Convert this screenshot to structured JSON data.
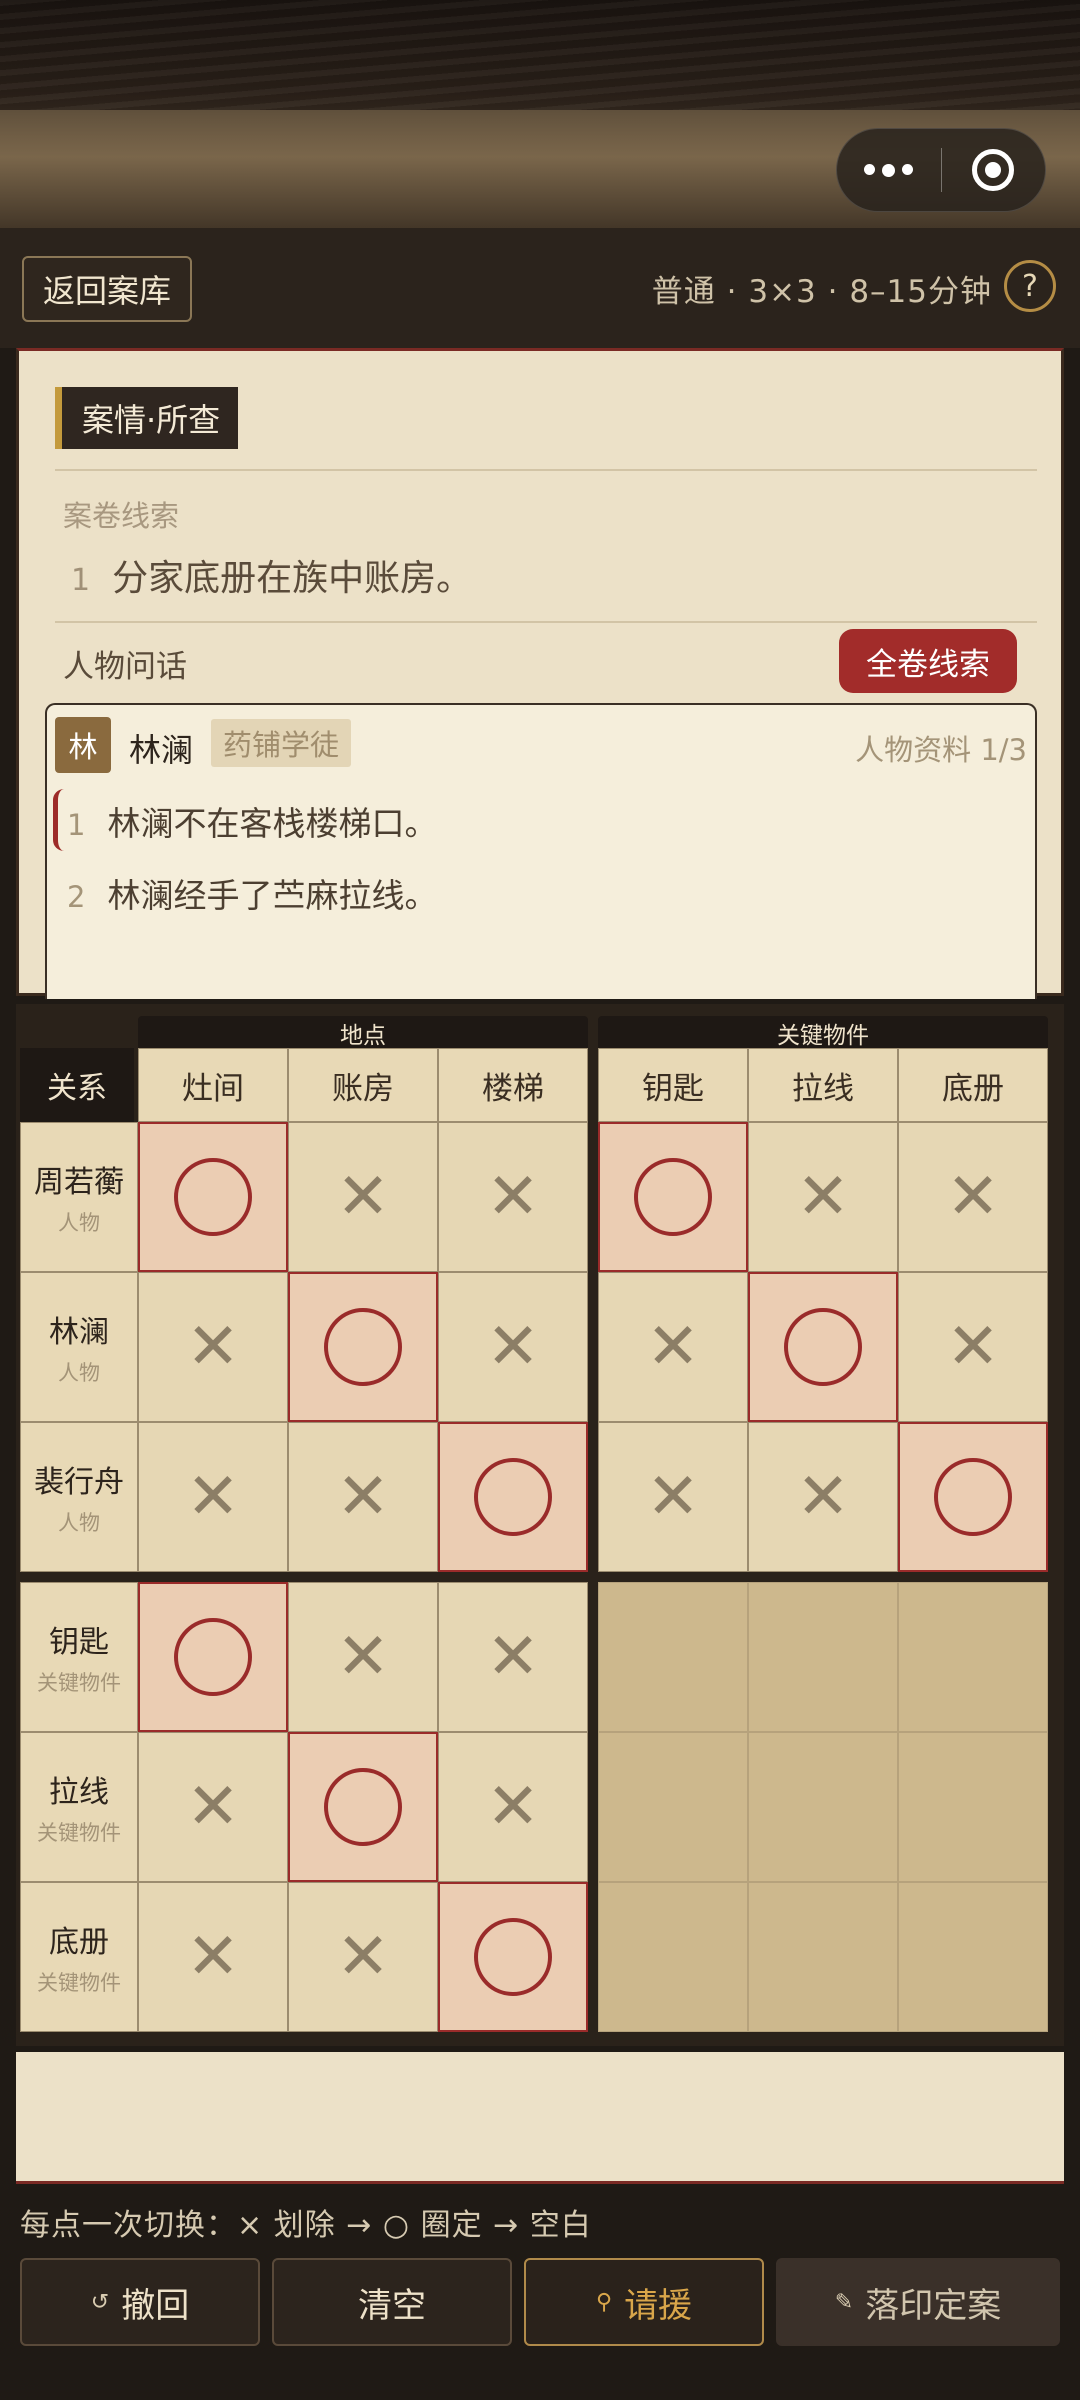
{
  "header": {
    "back_label": "返回案库",
    "meta": "普通 · 3×3 · 8–15分钟",
    "help_label": "?"
  },
  "case": {
    "tag": "案情·所查",
    "dossier_label": "案卷线索",
    "dossier_clues": [
      {
        "num": "1",
        "text": "分家底册在族中账房。"
      }
    ],
    "people_label": "人物问话",
    "all_clues_label": "全卷线索",
    "person": {
      "avatar": "林",
      "name": "林澜",
      "role": "药铺学徒",
      "index": "人物资料 1/3",
      "statements": [
        {
          "num": "1",
          "text": "林澜不在客栈楼梯口。",
          "active": true
        },
        {
          "num": "2",
          "text": "林澜经手了苎麻拉线。",
          "active": false
        }
      ]
    }
  },
  "grid": {
    "corner_label": "关系",
    "groups": [
      "地点",
      "关键物件"
    ],
    "columns": [
      "灶间",
      "账房",
      "楼梯",
      "钥匙",
      "拉线",
      "底册"
    ],
    "rows": [
      {
        "name": "周若蘅",
        "type": "人物"
      },
      {
        "name": "林澜",
        "type": "人物"
      },
      {
        "name": "裴行舟",
        "type": "人物"
      },
      {
        "name": "钥匙",
        "type": "关键物件"
      },
      {
        "name": "拉线",
        "type": "关键物件"
      },
      {
        "name": "底册",
        "type": "关键物件"
      }
    ],
    "marks": [
      [
        "O",
        "X",
        "X",
        "O",
        "X",
        "X"
      ],
      [
        "X",
        "O",
        "X",
        "X",
        "O",
        "X"
      ],
      [
        "X",
        "X",
        "O",
        "X",
        "X",
        "O"
      ],
      [
        "O",
        "X",
        "X",
        "",
        "",
        ""
      ],
      [
        "X",
        "O",
        "X",
        "",
        "",
        ""
      ],
      [
        "X",
        "X",
        "O",
        "",
        "",
        ""
      ]
    ],
    "x_glyph": "✕"
  },
  "footer": {
    "hint": "每点一次切换：× 划除 → ○ 圈定 → 空白",
    "buttons": {
      "undo": {
        "icon": "↺",
        "label": "撤回"
      },
      "clear": {
        "label": "清空"
      },
      "assist": {
        "icon": "⚲",
        "label": "请援"
      },
      "final": {
        "icon": "✎",
        "label": "落印定案"
      }
    }
  },
  "colors": {
    "accent_red": "#a22c2a",
    "gold": "#c49a3c",
    "paper": "#ece1c8",
    "dark": "#2b231c"
  }
}
